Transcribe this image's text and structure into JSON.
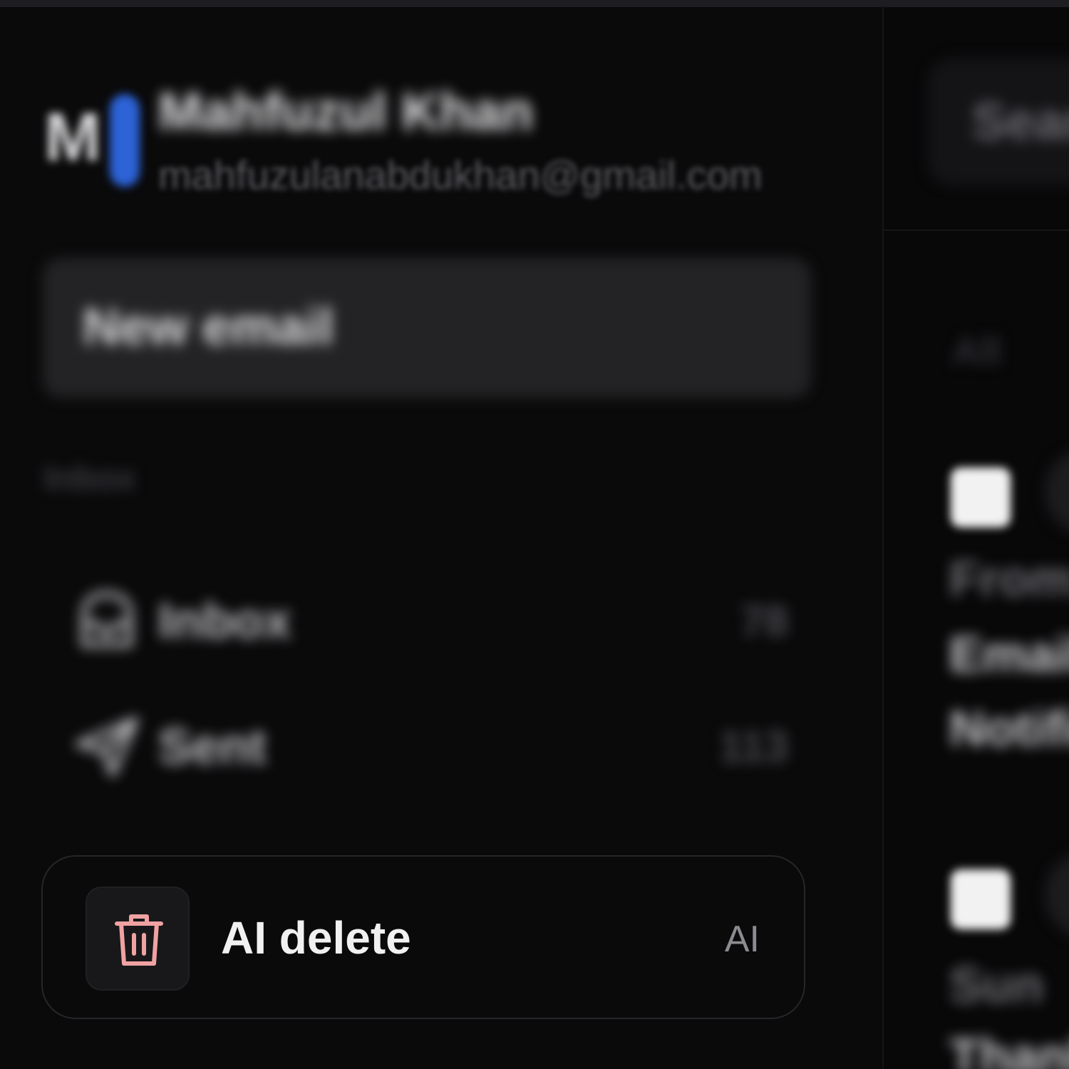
{
  "account": {
    "avatar_initial": "M",
    "name": "Mahfuzul Khan",
    "email": "mahfuzulanabdukhan@gmail.com"
  },
  "new_email": {
    "label": "New email"
  },
  "section": {
    "label": "Inbox"
  },
  "nav": {
    "inbox": {
      "label": "Inbox",
      "count": "78",
      "icon": "inbox-tray-icon"
    },
    "sent": {
      "label": "Sent",
      "count": "113",
      "icon": "send-icon"
    }
  },
  "ai_delete": {
    "label": "AI delete",
    "badge": "AI",
    "icon": "trash-icon",
    "icon_color": "#f0a2a2"
  },
  "right_pane": {
    "search_label": "Search",
    "filter_label": "All",
    "emails": [
      {
        "line1": "From",
        "line2": "Email",
        "line3": "Notification"
      },
      {
        "line1": "Sun",
        "line2": "Thank"
      }
    ]
  },
  "colors": {
    "background": "#070708",
    "avatar_accent": "#2d63d7",
    "button_bg": "#232325"
  }
}
